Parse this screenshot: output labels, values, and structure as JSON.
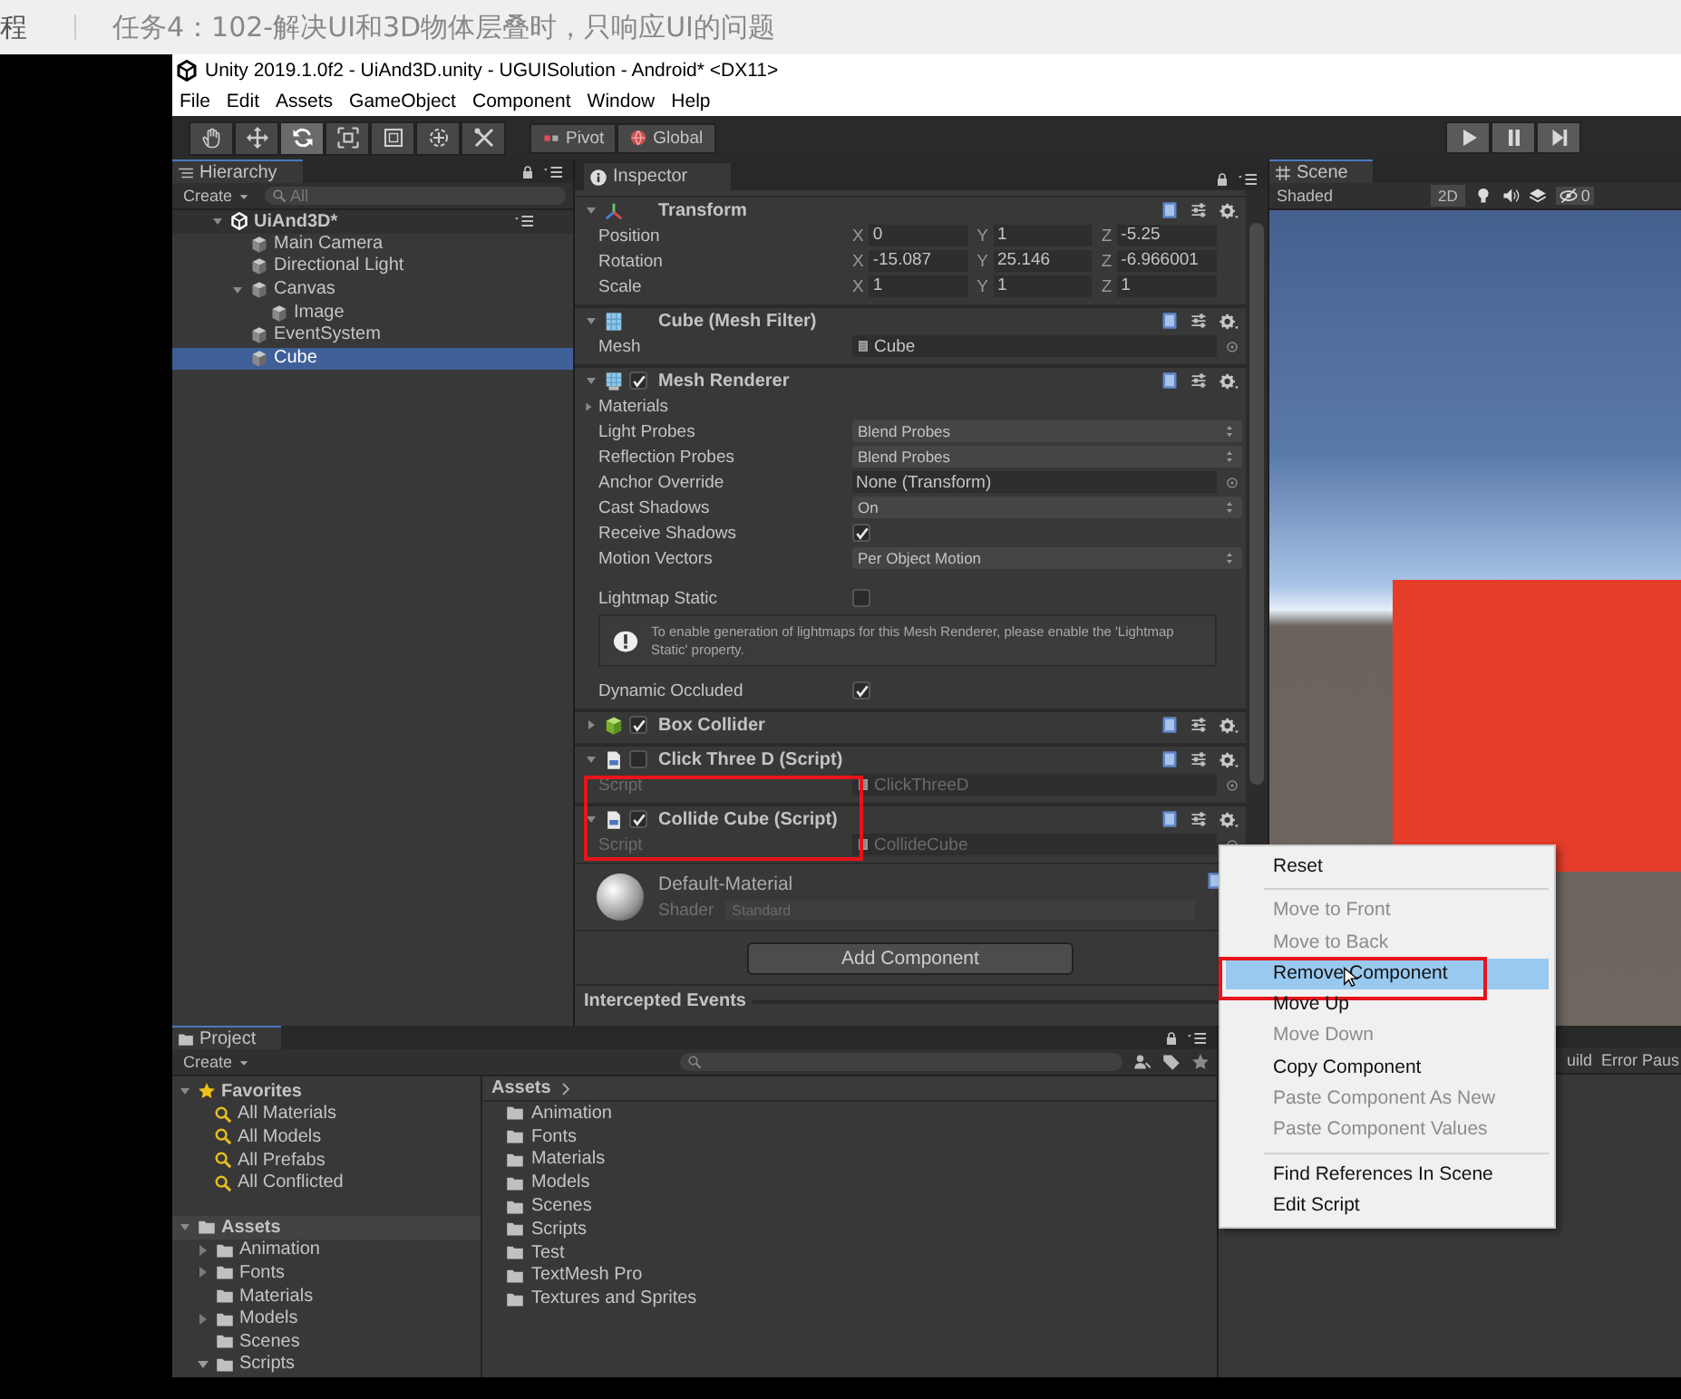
{
  "course_header": {
    "left_fragment": "程",
    "title": "任务4：102-解决UI和3D物体层叠时，只响应UI的问题"
  },
  "window": {
    "title": "Unity 2019.1.0f2 - UiAnd3D.unity - UGUISolution - Android* <DX11>"
  },
  "menu": [
    "File",
    "Edit",
    "Assets",
    "GameObject",
    "Component",
    "Window",
    "Help"
  ],
  "toolbar": {
    "tools": [
      {
        "kind": "hand",
        "selected": false
      },
      {
        "kind": "move",
        "selected": false
      },
      {
        "kind": "rotate",
        "selected": true
      },
      {
        "kind": "scale",
        "selected": false
      },
      {
        "kind": "rect",
        "selected": false
      },
      {
        "kind": "transform",
        "selected": false
      },
      {
        "kind": "custom",
        "selected": false
      }
    ],
    "pivot": "Pivot",
    "global": "Global"
  },
  "hierarchy": {
    "tab": "Hierarchy",
    "create": "Create",
    "search_placeholder": "All",
    "scene": "UiAnd3D*",
    "items": [
      {
        "label": "Main Camera",
        "selected": false
      },
      {
        "label": "Directional Light",
        "selected": false
      },
      {
        "label": "Canvas",
        "selected": false,
        "children": [
          {
            "label": "Image",
            "selected": false
          }
        ]
      },
      {
        "label": "EventSystem",
        "selected": false
      },
      {
        "label": "Cube",
        "selected": true
      }
    ]
  },
  "inspector": {
    "tab": "Inspector",
    "components": [
      {
        "kind": "transform",
        "title": "Transform",
        "expanded": true,
        "highlighted": false,
        "rows": [
          {
            "kind": "vector",
            "label": "Position",
            "values": [
              {
                "axis": "X",
                "value": "0"
              },
              {
                "axis": "Y",
                "value": "1"
              },
              {
                "axis": "Z",
                "value": "-5.25"
              }
            ]
          },
          {
            "kind": "vector",
            "label": "Rotation",
            "values": [
              {
                "axis": "X",
                "value": "-15.087"
              },
              {
                "axis": "Y",
                "value": "25.146"
              },
              {
                "axis": "Z",
                "value": "-6.966001"
              }
            ]
          },
          {
            "kind": "vector",
            "label": "Scale",
            "values": [
              {
                "axis": "X",
                "value": "1"
              },
              {
                "axis": "Y",
                "value": "1"
              },
              {
                "axis": "Z",
                "value": "1"
              }
            ]
          }
        ]
      },
      {
        "kind": "mesh_filter",
        "title": "Cube (Mesh Filter)",
        "expanded": true,
        "highlighted": false,
        "rows": [
          {
            "kind": "object",
            "label": "Mesh",
            "value": "Cube",
            "asset": true,
            "disabled": false
          }
        ]
      },
      {
        "kind": "mesh_renderer",
        "title": "Mesh Renderer",
        "enabled": true,
        "expanded": true,
        "highlighted": false,
        "rows": [
          {
            "kind": "foldout",
            "label": "Materials"
          },
          {
            "kind": "dropdown",
            "label": "Light Probes",
            "value": "Blend Probes"
          },
          {
            "kind": "dropdown",
            "label": "Reflection Probes",
            "value": "Blend Probes"
          },
          {
            "kind": "object",
            "label": "Anchor Override",
            "value": "None (Transform)",
            "asset": false,
            "disabled": false
          },
          {
            "kind": "dropdown",
            "label": "Cast Shadows",
            "value": "On"
          },
          {
            "kind": "checkbox",
            "label": "Receive Shadows",
            "checked": true
          },
          {
            "kind": "dropdown",
            "label": "Motion Vectors",
            "value": "Per Object Motion"
          },
          {
            "kind": "spacer"
          },
          {
            "kind": "checkbox",
            "label": "Lightmap Static",
            "checked": false
          },
          {
            "kind": "help",
            "text": "To enable generation of lightmaps for this Mesh Renderer, please enable the 'Lightmap Static' property."
          },
          {
            "kind": "checkbox",
            "label": "Dynamic Occluded",
            "checked": true
          }
        ]
      },
      {
        "kind": "box_collider",
        "title": "Box Collider",
        "enabled": true,
        "expanded": false,
        "highlighted": false
      },
      {
        "kind": "script",
        "title": "Click Three D (Script)",
        "enabled": false,
        "expanded": true,
        "highlighted": false,
        "rows": [
          {
            "kind": "object",
            "label": "Script",
            "value": "ClickThreeD",
            "asset": true,
            "disabled": true
          }
        ]
      },
      {
        "kind": "script",
        "title": "Collide Cube (Script)",
        "enabled": true,
        "expanded": true,
        "highlighted": true,
        "rows": [
          {
            "kind": "object",
            "label": "Script",
            "value": "CollideCube",
            "asset": true,
            "disabled": true
          }
        ]
      }
    ],
    "material": {
      "name": "Default-Material",
      "shader_label": "Shader",
      "shader": "Standard"
    },
    "add_component": "Add Component",
    "section": "Intercepted Events"
  },
  "scene": {
    "tab": "Scene",
    "shading": "Shaded",
    "mode_2d": "2D",
    "hidden_count": "0"
  },
  "project": {
    "tab": "Project",
    "create": "Create",
    "favorites": {
      "label": "Favorites",
      "items": [
        "All Materials",
        "All Models",
        "All Prefabs",
        "All Conflicted"
      ]
    },
    "assets": {
      "label": "Assets",
      "children": [
        {
          "label": "Animation",
          "expandable": true,
          "expanded": false
        },
        {
          "label": "Fonts",
          "expandable": true,
          "expanded": false
        },
        {
          "label": "Materials",
          "expandable": false
        },
        {
          "label": "Models",
          "expandable": true,
          "expanded": false
        },
        {
          "label": "Scenes",
          "expandable": false
        },
        {
          "label": "Scripts",
          "expandable": true,
          "expanded": true
        }
      ]
    },
    "breadcrumb": "Assets",
    "folders": [
      "Animation",
      "Fonts",
      "Materials",
      "Models",
      "Scenes",
      "Scripts",
      "Test",
      "TextMesh Pro",
      "Textures and Sprites"
    ]
  },
  "console": {
    "buttons": [
      "uild",
      "Error Paus"
    ]
  },
  "context_menu": {
    "items": [
      {
        "kind": "item",
        "label": "Reset",
        "disabled": false,
        "selected": false,
        "highlighted": false
      },
      {
        "kind": "separator"
      },
      {
        "kind": "item",
        "label": "Move to Front",
        "disabled": true,
        "selected": false,
        "highlighted": false
      },
      {
        "kind": "item",
        "label": "Move to Back",
        "disabled": true,
        "selected": false,
        "highlighted": false
      },
      {
        "kind": "item",
        "label": "Remove Component",
        "disabled": false,
        "selected": true,
        "highlighted": true
      },
      {
        "kind": "item",
        "label": "Move Up",
        "disabled": false,
        "selected": false,
        "highlighted": false
      },
      {
        "kind": "item",
        "label": "Move Down",
        "disabled": true,
        "selected": false,
        "highlighted": false
      },
      {
        "kind": "item",
        "label": "Copy Component",
        "disabled": false,
        "selected": false,
        "highlighted": false
      },
      {
        "kind": "item",
        "label": "Paste Component As New",
        "disabled": true,
        "selected": false,
        "highlighted": false
      },
      {
        "kind": "item",
        "label": "Paste Component Values",
        "disabled": true,
        "selected": false,
        "highlighted": false
      },
      {
        "kind": "separator"
      },
      {
        "kind": "item",
        "label": "Find References In Scene",
        "disabled": false,
        "selected": false,
        "highlighted": false
      },
      {
        "kind": "item",
        "label": "Edit Script",
        "disabled": false,
        "selected": false,
        "highlighted": false
      }
    ]
  }
}
